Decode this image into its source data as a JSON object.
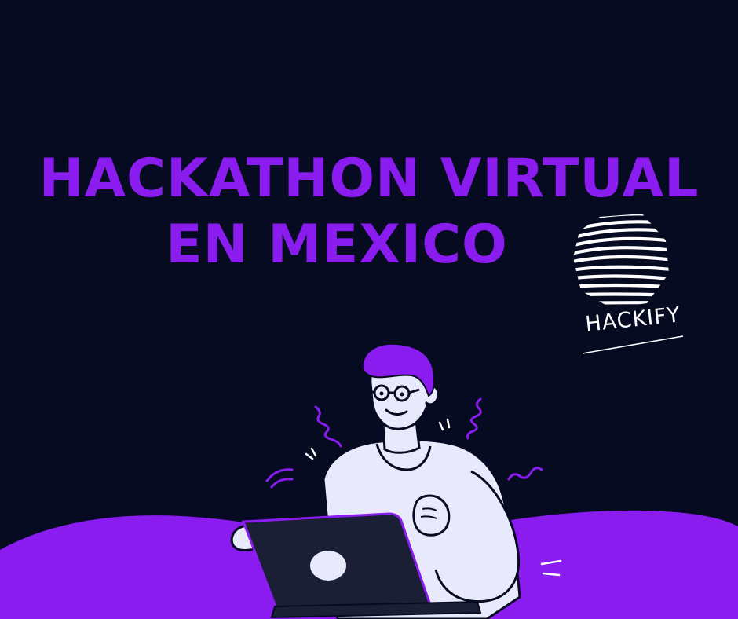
{
  "poster": {
    "headline_line1": "HACKATHON VIRTUAL",
    "headline_line2": "EN MEXICO",
    "logo_text": "HACKIFY",
    "logo_icon": "striped-sphere-icon",
    "illustration_icon": "person-with-laptop-icon"
  },
  "colors": {
    "background": "#070b22",
    "accent": "#8a1cf0",
    "shirt": "#e8eafc",
    "laptop": "#1a1f36"
  }
}
